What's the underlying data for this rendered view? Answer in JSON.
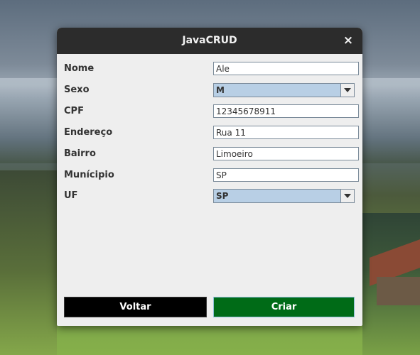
{
  "window": {
    "title": "JavaCRUD",
    "close_glyph": "×"
  },
  "form": {
    "nome": {
      "label": "Nome",
      "value": "Ale"
    },
    "sexo": {
      "label": "Sexo",
      "value": "M"
    },
    "cpf": {
      "label": "CPF",
      "value": "12345678911"
    },
    "endereco": {
      "label": "Endereço",
      "value": "Rua 11"
    },
    "bairro": {
      "label": "Bairro",
      "value": "Limoeiro"
    },
    "municipio": {
      "label": "Munícipio",
      "value": "SP"
    },
    "uf": {
      "label": "UF",
      "value": "SP"
    }
  },
  "buttons": {
    "voltar": "Voltar",
    "criar": "Criar"
  },
  "colors": {
    "titlebar": "#2c2c2c",
    "voltar_bg": "#000000",
    "criar_bg": "#006b17",
    "combo_bg": "#b8cfe5"
  }
}
